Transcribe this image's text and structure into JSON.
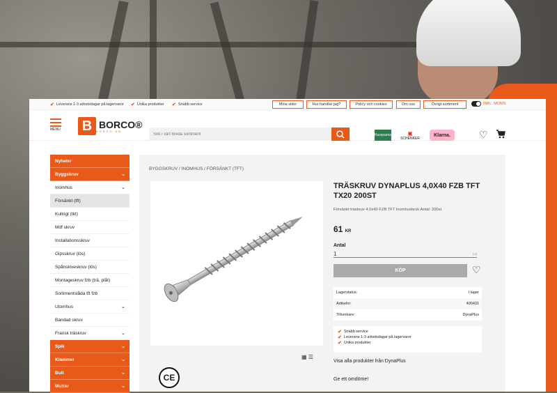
{
  "topbar": {
    "usps": [
      "Leverans 1-3 arbetsdagar på lagervaror",
      "Unika produkter",
      "Snabb service"
    ],
    "buttons": [
      "Mina sidor",
      "Hur handlar jag?",
      "Policy och cookies",
      "Om oss",
      "Övrigt sortiment"
    ],
    "vat_label": "INKL. MOMS"
  },
  "header": {
    "menu_label": "MENU",
    "logo_text": "BORCO®",
    "logo_sub": "BORCO AB",
    "search_placeholder": "Sök i vårt breda sortiment",
    "partners": [
      "Husqvarna",
      "SCHENKER",
      "Klarna."
    ]
  },
  "sidebar": {
    "items": [
      {
        "label": "Nyheter"
      },
      {
        "label": "Byggskruv"
      },
      {
        "label": "Inomhus"
      },
      {
        "label": "Försänkt (tft)"
      },
      {
        "label": "Kullrigt (tkt)"
      },
      {
        "label": "Mdf skruv"
      },
      {
        "label": "Installationsskruv"
      },
      {
        "label": "Gipsskruv (lös)"
      },
      {
        "label": "Spånskiveskruv (lös)"
      },
      {
        "label": "Montageskruv fzb (trä, plåt)"
      },
      {
        "label": "Sortimentslåda tft fzb"
      },
      {
        "label": "Utomhus"
      },
      {
        "label": "Bandad skruv"
      },
      {
        "label": "Fransk träskruv"
      },
      {
        "label": "Spik"
      },
      {
        "label": "Klammer"
      },
      {
        "label": "Bult"
      },
      {
        "label": "Mutter"
      }
    ]
  },
  "breadcrumb": [
    "BYGGSKRUV",
    "INOMHUS",
    "FÖRSÄNKT (TFT)"
  ],
  "product": {
    "title": "TRÄSKRUV DYNAPLUS 4,0X40 FZB TFT TX20 200ST",
    "description": "Försänkt träskruv 4,0x40 FZB TFT inomhusbruk Antal: 200st",
    "price": "61",
    "currency": "KR",
    "qty_label": "Antal",
    "qty_value": "1",
    "qty_unit": "(st)",
    "buy_label": "KÖP",
    "info": [
      {
        "k": "Lagerstatus:",
        "v": "I lager"
      },
      {
        "k": "Artikelnr:",
        "v": "400431"
      },
      {
        "k": "Tillverkare:",
        "v": "DynaPlus"
      }
    ],
    "usps": [
      "Snabb service",
      "Leverans 1-3 arbetsdagar på lagervaror",
      "Unika produkter"
    ],
    "all_products": "Visa alla produkter från DynaPlus",
    "review": "Ge ett omdöme!",
    "ce_mark": "CE"
  }
}
